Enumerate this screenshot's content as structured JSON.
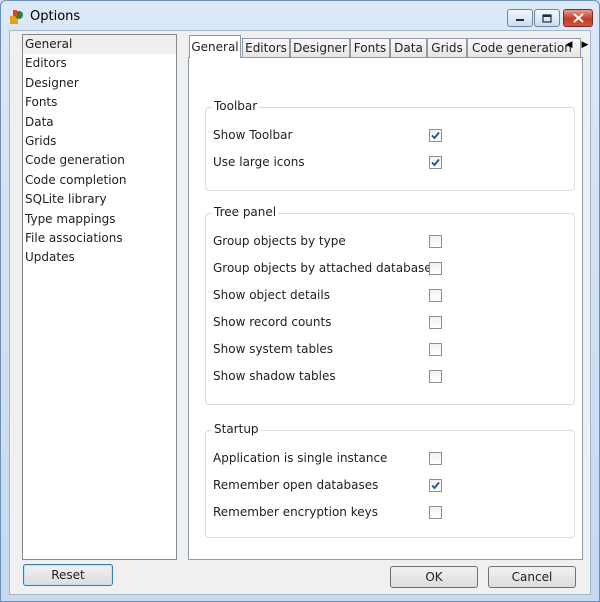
{
  "window": {
    "title": "Options"
  },
  "nav": {
    "items": [
      {
        "label": "General",
        "selected": true
      },
      {
        "label": "Editors"
      },
      {
        "label": "Designer"
      },
      {
        "label": "Fonts"
      },
      {
        "label": "Data"
      },
      {
        "label": "Grids"
      },
      {
        "label": "Code generation"
      },
      {
        "label": "Code completion"
      },
      {
        "label": "SQLite library"
      },
      {
        "label": "Type mappings"
      },
      {
        "label": "File associations"
      },
      {
        "label": "Updates"
      }
    ]
  },
  "tabs": [
    {
      "label": "General",
      "active": true
    },
    {
      "label": "Editors"
    },
    {
      "label": "Designer"
    },
    {
      "label": "Fonts"
    },
    {
      "label": "Data"
    },
    {
      "label": "Grids"
    },
    {
      "label": "Code generation"
    }
  ],
  "groups": {
    "toolbar": {
      "title": "Toolbar",
      "options": [
        {
          "label": "Show Toolbar",
          "checked": true
        },
        {
          "label": "Use large icons",
          "checked": true
        }
      ]
    },
    "tree_panel": {
      "title": "Tree panel",
      "options": [
        {
          "label": "Group objects by type",
          "checked": false
        },
        {
          "label": "Group objects by attached databases",
          "checked": false
        },
        {
          "label": "Show object details",
          "checked": false
        },
        {
          "label": "Show record counts",
          "checked": false
        },
        {
          "label": "Show system tables",
          "checked": false
        },
        {
          "label": "Show shadow tables",
          "checked": false
        }
      ]
    },
    "startup": {
      "title": "Startup",
      "options": [
        {
          "label": "Application is single instance",
          "checked": false
        },
        {
          "label": "Remember open databases",
          "checked": true
        },
        {
          "label": "Remember encryption keys",
          "checked": false
        }
      ]
    }
  },
  "buttons": {
    "reset": "Reset",
    "ok": "OK",
    "cancel": "Cancel"
  },
  "icons": {
    "app": "options-app-icon",
    "minimize": "minimize-icon",
    "maximize": "maximize-icon",
    "close": "close-icon",
    "tab_left": "chevron-left-icon",
    "tab_right": "chevron-right-icon",
    "check": "checkmark-icon"
  },
  "colors": {
    "accent": "#3c7fb1",
    "check": "#2b4d8a",
    "close": "#c43c2b"
  }
}
